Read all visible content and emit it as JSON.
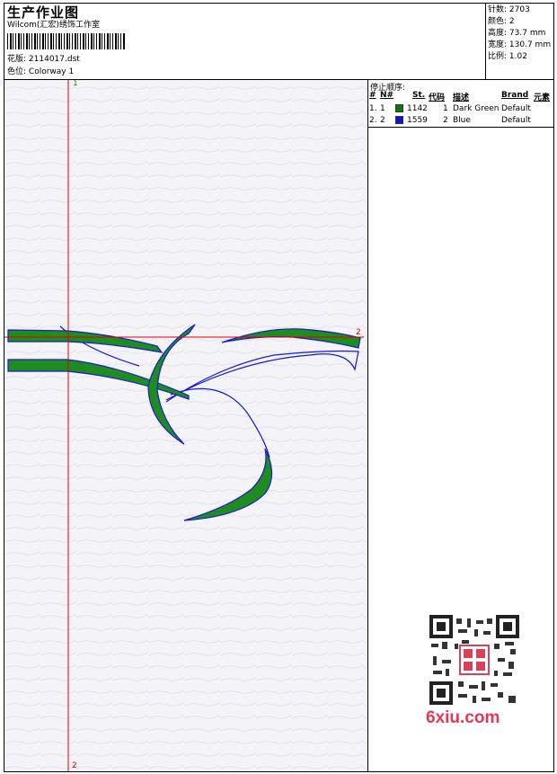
{
  "header": {
    "title": "生产作业图",
    "company": "Wilcom(汇宏)绣饰工作室",
    "design_label": "花版:",
    "design_value": "2114017.dst",
    "colorway_label": "色位:",
    "colorway_value": "Colorway 1"
  },
  "stats": {
    "stitches_label": "针数:",
    "stitches_value": "2703",
    "colors_label": "颜色:",
    "colors_value": "2",
    "height_label": "高度:",
    "height_value": "73.7 mm",
    "width_label": "宽度:",
    "width_value": "130.7 mm",
    "scale_label": "比例:",
    "scale_value": "1.02"
  },
  "stop_sequence": {
    "title": "停止顺序:",
    "columns": [
      "#",
      "N#",
      "St.",
      "代码",
      "描述",
      "Brand",
      "元素"
    ],
    "rows": [
      {
        "index": "1.",
        "n": "1",
        "stitches": "1142",
        "code": "1",
        "description": "Dark Green",
        "brand": "Default",
        "color": "#0a7a0a"
      },
      {
        "index": "2.",
        "n": "2",
        "stitches": "1559",
        "code": "2",
        "description": "Blue",
        "brand": "Default",
        "color": "#1414d2"
      }
    ]
  },
  "axes": {
    "v_top": "1",
    "v_bottom": "2",
    "h_right": "2"
  },
  "watermark": {
    "qr_center": "双鱼图标",
    "logo": "6xiu.com"
  },
  "colors": {
    "green": "#1e8c1e",
    "blue": "#1a1ad6",
    "guide": "#e00000"
  }
}
